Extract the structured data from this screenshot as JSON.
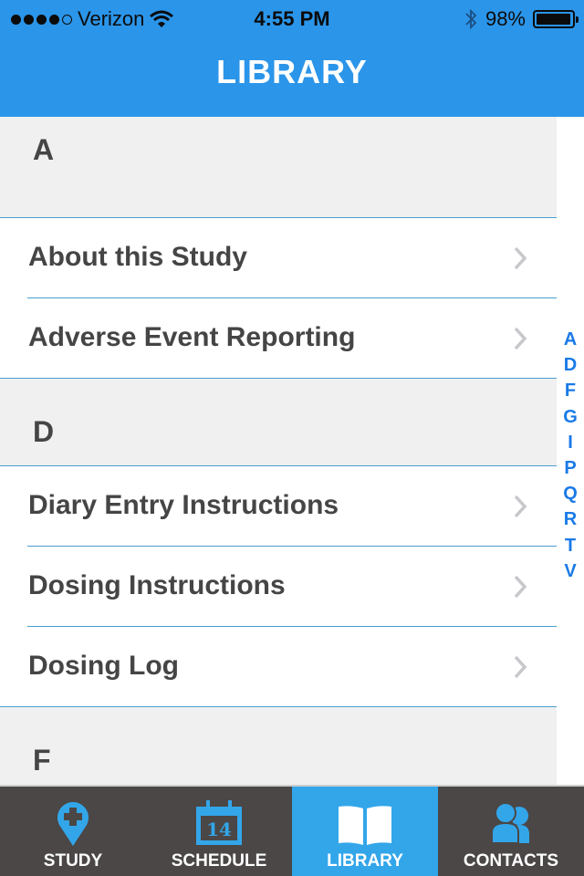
{
  "status_bar": {
    "signal_bars_filled": 4,
    "signal_bars_total": 5,
    "carrier": "Verizon",
    "time": "4:55 PM",
    "battery_percent": "98%",
    "battery_level": 0.98
  },
  "header": {
    "title": "LIBRARY"
  },
  "sections": [
    {
      "letter": "A",
      "items": [
        {
          "label": "About this Study"
        },
        {
          "label": "Adverse Event Reporting"
        }
      ]
    },
    {
      "letter": "D",
      "items": [
        {
          "label": "Diary Entry Instructions"
        },
        {
          "label": "Dosing Instructions"
        },
        {
          "label": "Dosing Log"
        }
      ]
    },
    {
      "letter": "F",
      "items": []
    }
  ],
  "index_letters": [
    "A",
    "D",
    "F",
    "G",
    "I",
    "P",
    "Q",
    "R",
    "T",
    "V"
  ],
  "tabs": [
    {
      "label": "STUDY",
      "icon": "map-pin-plus-icon",
      "active": false
    },
    {
      "label": "SCHEDULE",
      "icon": "calendar-icon",
      "calendar_day": "14",
      "active": false
    },
    {
      "label": "LIBRARY",
      "icon": "book-icon",
      "active": true
    },
    {
      "label": "CONTACTS",
      "icon": "people-icon",
      "active": false
    }
  ],
  "colors": {
    "accent": "#2b95e9",
    "tab_active": "#33a6ea",
    "tab_bar": "#4a4746",
    "section_bg": "#f0f0f0",
    "text": "#454545",
    "index_text": "#1a7ae6"
  }
}
